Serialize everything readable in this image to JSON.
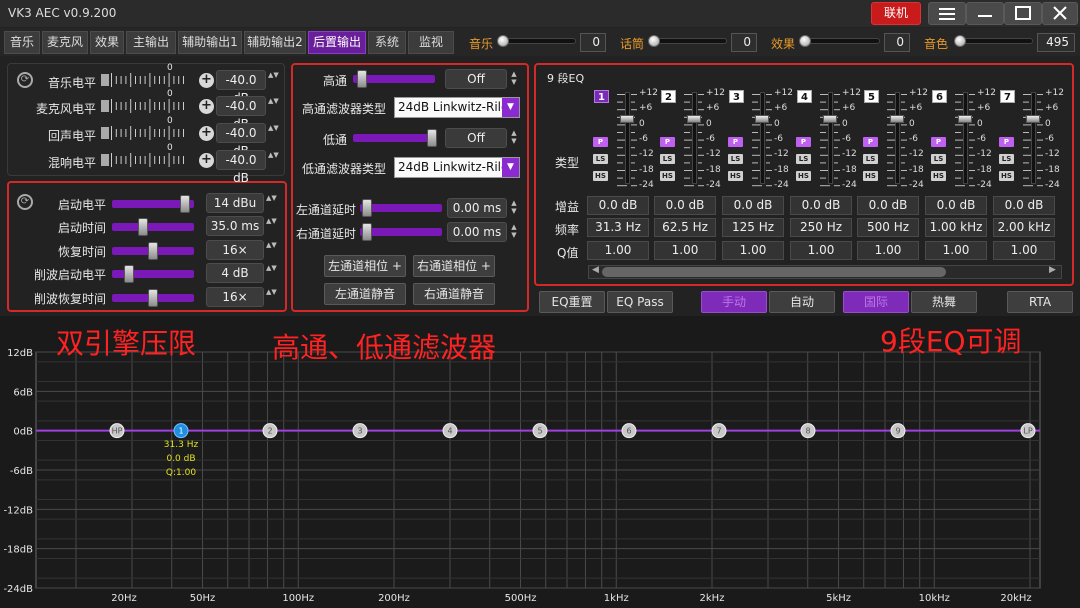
{
  "app": {
    "title": "VK3 AEC v0.9.200",
    "link_label": "联机"
  },
  "nav": {
    "tabs": [
      "音乐",
      "麦克风",
      "效果",
      "主输出",
      "辅助输出1",
      "辅助输出2",
      "后置输出",
      "系统",
      "监视"
    ],
    "active": "后置输出"
  },
  "volumes": [
    {
      "label": "音乐",
      "value": "0",
      "level": 0.0
    },
    {
      "label": "话筒",
      "value": "0",
      "level": 0.0
    },
    {
      "label": "效果",
      "value": "0",
      "level": 0.0
    },
    {
      "label": "音色",
      "value": "495",
      "level": 0.0
    }
  ],
  "levels": {
    "scale_zero": "0",
    "rows": [
      {
        "label": "音乐电平",
        "value": "-40.0 dB"
      },
      {
        "label": "麦克风电平",
        "value": "-40.0 dB"
      },
      {
        "label": "回声电平",
        "value": "-40.0 dB"
      },
      {
        "label": "混响电平",
        "value": "-40.0 dB"
      }
    ]
  },
  "limiter": {
    "rows": [
      {
        "label": "启动电平",
        "value": "14 dBu"
      },
      {
        "label": "启动时间",
        "value": "35.0 ms"
      },
      {
        "label": "恢复时间",
        "value": "16×"
      },
      {
        "label": "削波启动电平",
        "value": "4 dB"
      },
      {
        "label": "削波恢复时间",
        "value": "16×"
      }
    ]
  },
  "filter": {
    "highpass_label": "高通",
    "highpass_value": "Off",
    "hp_type_label": "高通滤波器类型",
    "hp_type": "24dB Linkwitz-Riley",
    "lowpass_label": "低通",
    "lowpass_value": "Off",
    "lp_type_label": "低通滤波器类型",
    "lp_type": "24dB Linkwitz-Riley",
    "left_delay_label": "左通道延时",
    "left_delay": "0.00 ms",
    "right_delay_label": "右通道延时",
    "right_delay": "0.00 ms",
    "left_phase": "左通道相位 +",
    "right_phase": "右通道相位 +",
    "left_mute": "左通道静音",
    "right_mute": "右通道静音"
  },
  "eq": {
    "title": "9 段EQ",
    "type_label": "类型",
    "db_ticks": [
      "+12",
      "+6",
      "0",
      "-6",
      "-12",
      "-18",
      "-24"
    ],
    "band_numbers": [
      "1",
      "2",
      "3",
      "4",
      "5",
      "6",
      "7"
    ],
    "types": [
      "P",
      "LS",
      "HS"
    ],
    "gain_label": "增益",
    "freq_label": "频率",
    "q_label": "Q值",
    "gains": [
      "0.0 dB",
      "0.0 dB",
      "0.0 dB",
      "0.0 dB",
      "0.0 dB",
      "0.0 dB",
      "0.0 dB"
    ],
    "freqs": [
      "31.3 Hz",
      "62.5 Hz",
      "125 Hz",
      "250 Hz",
      "500 Hz",
      "1.00 kHz",
      "2.00 kHz"
    ],
    "qs": [
      "1.00",
      "1.00",
      "1.00",
      "1.00",
      "1.00",
      "1.00",
      "1.00"
    ]
  },
  "eq_buttons": {
    "reset": "EQ重置",
    "pass": "EQ Pass",
    "manual": "手动",
    "auto": "自动",
    "mode_a": "国际",
    "mode_b": "热舞",
    "rta": "RTA"
  },
  "overlays": {
    "left": "双引擎压限",
    "middle": "高通、低通滤波器",
    "right": "9段EQ可调"
  },
  "graph": {
    "y_labels": [
      "12dB",
      "6dB",
      "0dB",
      "-6dB",
      "-12dB",
      "-18dB",
      "-24dB"
    ],
    "x_labels": [
      "20Hz",
      "50Hz",
      "100Hz",
      "200Hz",
      "500Hz",
      "1kHz",
      "2kHz",
      "5kHz",
      "10kHz",
      "20kHz"
    ],
    "points": [
      "HP",
      "1",
      "2",
      "3",
      "4",
      "5",
      "6",
      "7",
      "8",
      "9",
      "LP"
    ],
    "tooltip": {
      "freq": "31.3 Hz",
      "gain": "0.0 dB",
      "q": "Q:1.00"
    }
  }
}
